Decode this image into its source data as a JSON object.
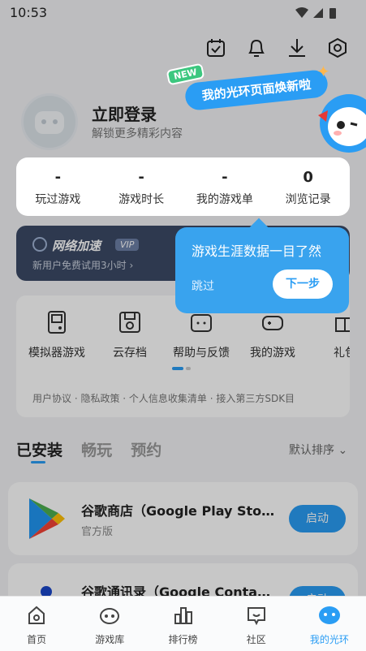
{
  "status_bar": {
    "time": "10:53"
  },
  "profile": {
    "title": "立即登录",
    "subtitle": "解锁更多精彩内容"
  },
  "banner": {
    "badge": "NEW",
    "text": "我的光环页面焕新啦"
  },
  "stats": [
    {
      "value": "-",
      "label": "玩过游戏"
    },
    {
      "value": "-",
      "label": "游戏时长"
    },
    {
      "value": "-",
      "label": "我的游戏单"
    },
    {
      "value": "0",
      "label": "浏览记录"
    }
  ],
  "accelerator": {
    "title": "网络加速",
    "badge": "VIP",
    "subtitle": "新用户免费试用3小时 ›"
  },
  "tools": [
    "模拟器游戏",
    "云存档",
    "帮助与反馈",
    "我的游戏",
    "礼包"
  ],
  "links": "用户协议 · 隐私政策 · 个人信息收集清单 · 接入第三方SDK目",
  "tooltip": {
    "message": "游戏生涯数据一目了然",
    "skip": "跳过",
    "next": "下一步"
  },
  "tabs": [
    "已安装",
    "畅玩",
    "预约"
  ],
  "sort_label": "默认排序 ⌄",
  "apps": [
    {
      "name": "谷歌商店（Google Play Store）",
      "sub": "官方版",
      "button": "启动"
    },
    {
      "name": "谷歌通讯录（Google Contacts）",
      "sub": "",
      "button": "启动"
    }
  ],
  "bottom_nav": [
    {
      "label": "首页",
      "icon": "home-icon"
    },
    {
      "label": "游戏库",
      "icon": "gamepad-icon"
    },
    {
      "label": "排行榜",
      "icon": "ranking-icon"
    },
    {
      "label": "社区",
      "icon": "community-icon"
    },
    {
      "label": "我的光环",
      "icon": "profile-icon"
    }
  ],
  "colors": {
    "accent": "#2a9df4",
    "tooltip": "#39a3ee",
    "accel_bg": "#3b4a66"
  }
}
